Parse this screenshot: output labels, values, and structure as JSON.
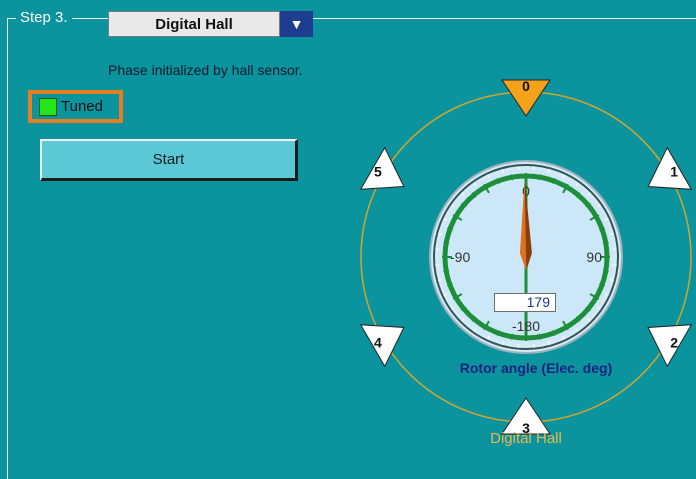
{
  "step": {
    "title": "Step 3."
  },
  "mode_select": {
    "value": "Digital Hall",
    "arrow": "▼"
  },
  "phase_text": "Phase initialized by hall sensor.",
  "tuned": {
    "label": "Tuned",
    "led_color": "#22e61a",
    "state": true
  },
  "start_button": {
    "label": "Start"
  },
  "hall_dial": {
    "caption": "Digital Hall",
    "active_sector": 0,
    "sectors": [
      "0",
      "1",
      "2",
      "3",
      "4",
      "5"
    ],
    "colors": {
      "active": "#f5a21b",
      "inactive": "#ffffff",
      "ring": "#d2a52f"
    }
  },
  "rotor_gauge": {
    "title": "Rotor angle (Elec. deg)",
    "ticks": [
      "0",
      "90",
      "-180",
      "-90"
    ],
    "value": 179,
    "value_text": "179",
    "colors": {
      "face": "#cce7f7",
      "arc": "#1d8f3a",
      "needle": "#e0701a",
      "title": "#1a237e"
    }
  }
}
